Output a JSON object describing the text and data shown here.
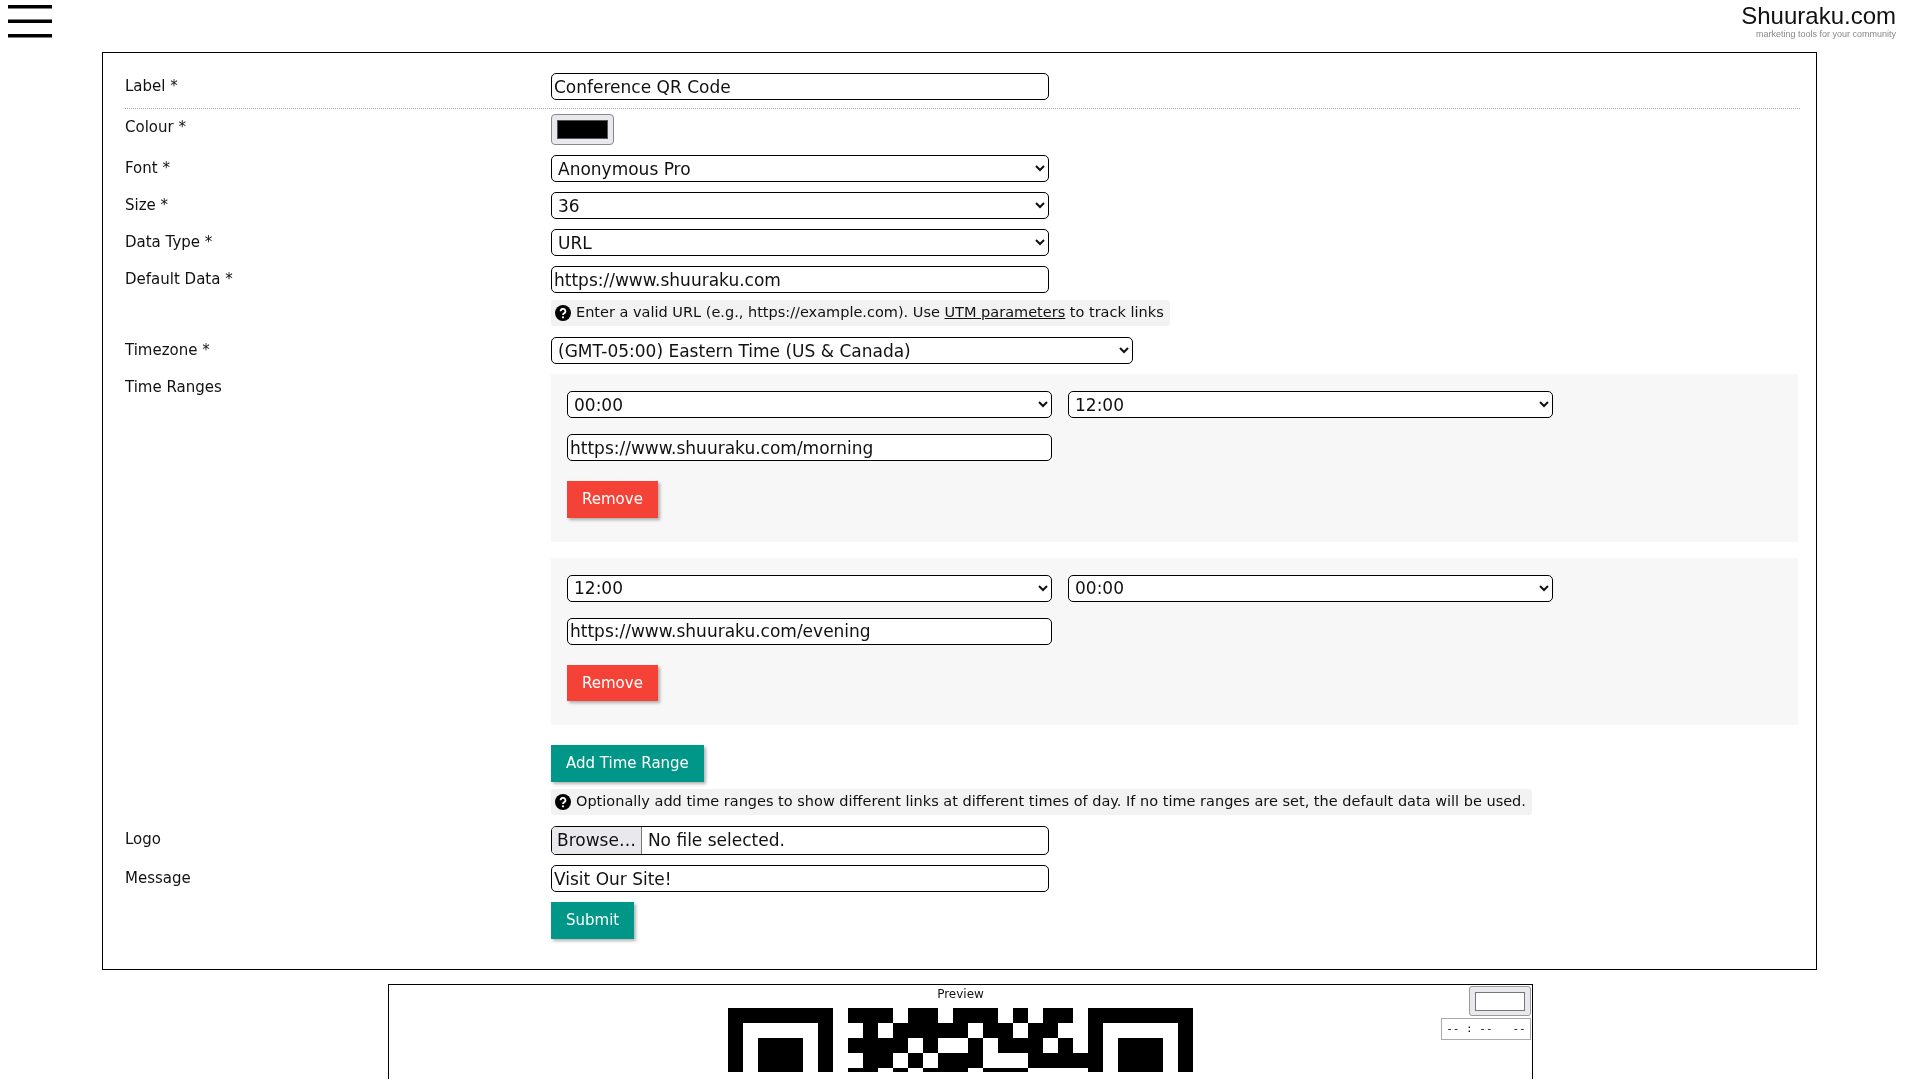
{
  "header": {
    "logo": "Shuuraku.com",
    "tagline": "marketing tools for your community"
  },
  "fields": [
    {
      "kind": "text",
      "label": "Label *",
      "value": "Conference QR Code"
    },
    {
      "kind": "colour",
      "label": "Colour *",
      "color": "#000000"
    },
    {
      "kind": "select",
      "label": "Font *",
      "value": "Anonymous Pro"
    },
    {
      "kind": "select",
      "label": "Size *",
      "value": "36"
    },
    {
      "kind": "select",
      "label": "Data Type *",
      "value": "URL"
    },
    {
      "kind": "text",
      "label": "Default Data *",
      "value": "https://www.shuuraku.com",
      "hint": {
        "before": "Enter a valid URL (e.g., https://example.com). Use ",
        "link": "UTM parameters",
        "after": " to track links"
      }
    },
    {
      "kind": "wideselect",
      "label": "Timezone *",
      "value": "(GMT-05:00) Eastern Time (US & Canada)"
    },
    {
      "kind": "timeranges",
      "label": "Time Ranges",
      "ranges": [
        {
          "start": "00:00",
          "end": "12:00",
          "url": "https://www.shuuraku.com/morning",
          "remove": "Remove"
        },
        {
          "start": "12:00",
          "end": "00:00",
          "url": "https://www.shuuraku.com/evening",
          "remove": "Remove"
        }
      ],
      "add": "Add Time Range",
      "hint": {
        "before": "Optionally add time ranges to show different links at different times of day. If no time ranges are set, the default data will be used."
      }
    },
    {
      "kind": "file",
      "label": "Logo",
      "button": "Browse…",
      "status": "No file selected."
    },
    {
      "kind": "text",
      "label": "Message",
      "value": "Visit Our Site!"
    }
  ],
  "submit": "Submit",
  "preview": {
    "title": "Preview",
    "time_placeholder": "-- : --   --"
  }
}
